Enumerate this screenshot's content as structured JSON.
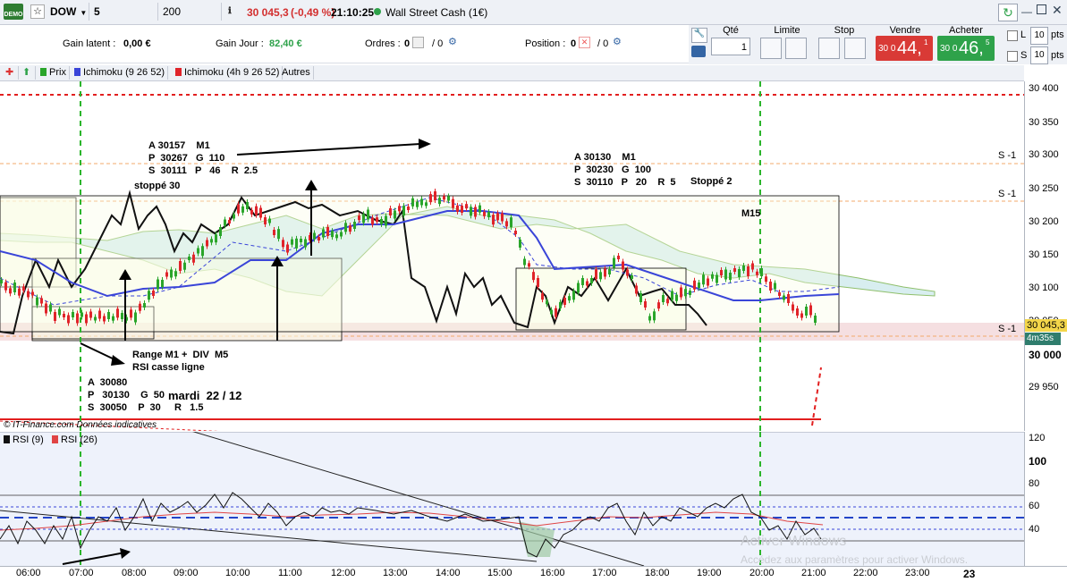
{
  "toolbar": {
    "demo_label": "DEMO",
    "instrument": "DOW",
    "timeframe": "5 minutes",
    "units": "200 unités",
    "price": "30 045,3",
    "change": "(-0,49 %)",
    "time": "21:10:25",
    "market": "Wall Street Cash (1€)"
  },
  "info": {
    "latent_label": "Gain latent :",
    "latent_value": "0,00 €",
    "day_label": "Gain Jour :",
    "day_value": "82,40 €",
    "orders_label": "Ordres :",
    "orders_a": "0",
    "orders_b": "/ 0",
    "positions_label": "Position :",
    "positions_a": "0",
    "positions_b": "/ 0"
  },
  "order_panel": {
    "qty_label": "Qté",
    "qty_value": "1",
    "limit_label": "Limite",
    "stop_label": "Stop",
    "sell_label": "Vendre",
    "buy_label": "Acheter",
    "sell_small": "30 0",
    "sell_big": "44,",
    "sell_sup": "1",
    "buy_small": "30 0",
    "buy_big": "46,",
    "buy_sup": "5",
    "l_label": "L",
    "s_label": "S",
    "l_value": "10",
    "s_value": "10",
    "pts": "pts"
  },
  "chart_bar": {
    "prix": "Prix",
    "ichi1": "Ichimoku (9 26 52)",
    "ichi2": "Ichimoku (4h 9 26 52)",
    "autres": "Autres"
  },
  "yaxis": [
    "30 400",
    "30 350",
    "30 300",
    "30 250",
    "30 200",
    "30 150",
    "30 100",
    "30 050",
    "30 000",
    "29 950"
  ],
  "yaxis_current": "30 045,3",
  "countdown": "4m35s",
  "rsi_axis": [
    "120",
    "100",
    "80",
    "60",
    "40"
  ],
  "xaxis": [
    "06:00",
    "07:00",
    "08:00",
    "09:00",
    "10:00",
    "11:00",
    "12:00",
    "13:00",
    "14:00",
    "15:00",
    "16:00",
    "17:00",
    "18:00",
    "19:00",
    "20:00",
    "21:00",
    "22:00",
    "23:00",
    "23"
  ],
  "s_labels": [
    "S -1",
    "S -1",
    "S -1"
  ],
  "annotations": {
    "a1": "A 30157    M1\nP  30267   G  110\nS  30111   P   46    R  2.5",
    "stoppe30": "stoppé 30",
    "a2": "A 30130    M1\nP  30230   G  100\nS  30110   P   20    R  5",
    "stoppe2": "Stoppé 2",
    "m15": "M15",
    "range": "Range M1 +  DIV  M5\nRSI casse ligne",
    "a3": "A  30080\nP   30130    G  50\nS  30050    P  30     R   1.5",
    "mardi": "mardi  22 / 12"
  },
  "credit": "© IT-Finance.com Données indicatives",
  "rsi_bar": {
    "rsi9": "RSI (9)",
    "rsi26": "RSI (26)"
  },
  "watermark": {
    "title": "Activer Windows",
    "sub": "Accédez aux paramètres pour activer Windows."
  },
  "colors": {
    "sell": "#d93a36",
    "buy": "#2ea24a",
    "up_candle": "#2aa52a",
    "down_candle": "#e0242a",
    "kijun": "#3a45d8"
  }
}
